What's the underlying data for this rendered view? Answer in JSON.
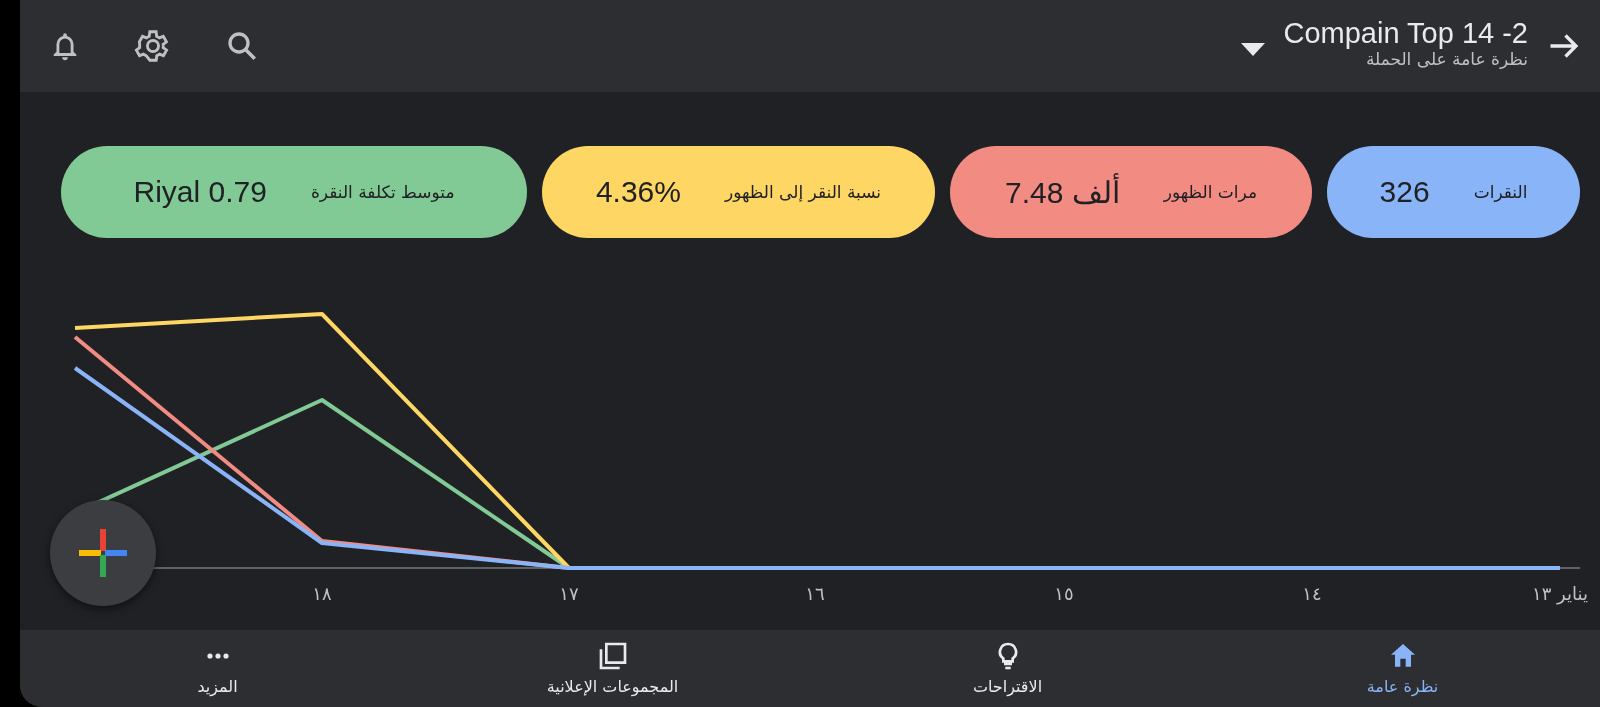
{
  "header": {
    "title": "Compain Top 14 -2",
    "subtitle": "نظرة عامة على الحملة"
  },
  "metrics": [
    {
      "label": "النقرات",
      "value": "326",
      "color": "#8ab4f8"
    },
    {
      "label": "مرات الظهور",
      "value": "7.48 ألف",
      "color": "#f28b82"
    },
    {
      "label": "نسبة النقر إلى الظهور",
      "value": "4.36%",
      "color": "#fdd663"
    },
    {
      "label": "متوسط تكلفة النقرة",
      "value": "Riyal 0.79",
      "color": "#81c995"
    }
  ],
  "chart": {
    "x_labels": [
      "يناير ١٣",
      "١٤",
      "١٥",
      "١٦",
      "١٧",
      "١٨"
    ]
  },
  "nav": [
    {
      "label": "نظرة عامة",
      "selected": true
    },
    {
      "label": "الاقتراحات",
      "selected": false
    },
    {
      "label": "المجموعات الإعلانية",
      "selected": false
    },
    {
      "label": "المزيد",
      "selected": false
    }
  ]
}
